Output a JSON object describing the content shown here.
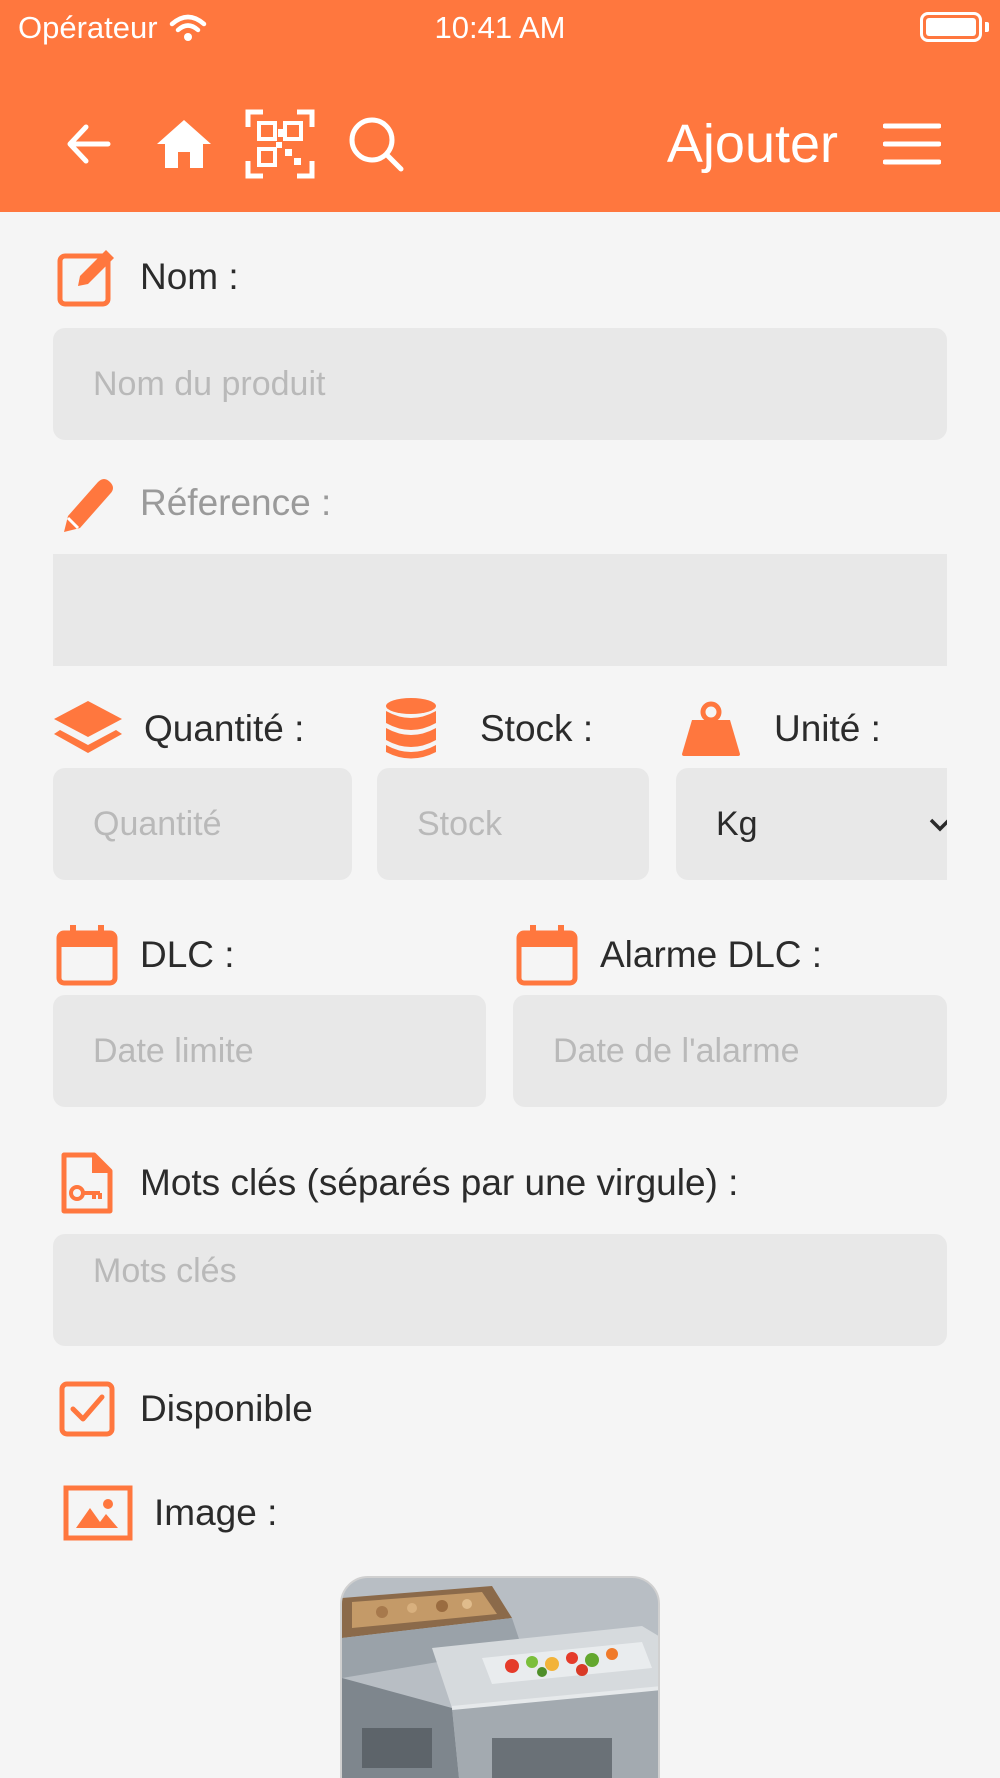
{
  "status_bar": {
    "carrier": "Opérateur",
    "time": "10:41 AM"
  },
  "header": {
    "title": "Ajouter"
  },
  "icons": {
    "back": "arrow-left-icon",
    "home": "home-icon",
    "scan": "qr-code-icon",
    "search": "search-icon",
    "menu": "hamburger-menu-icon"
  },
  "colors": {
    "accent": "#ff773e",
    "field_bg": "#e8e8e8",
    "background": "#f5f5f5",
    "placeholder": "#b9b9b9",
    "text": "#2b2b2b"
  },
  "form": {
    "nom": {
      "label": "Nom :",
      "placeholder": "Nom du produit",
      "value": ""
    },
    "reference": {
      "label": "Réference :",
      "value": ""
    },
    "quantite": {
      "label": "Quantité :",
      "placeholder": "Quantité",
      "value": ""
    },
    "stock": {
      "label": "Stock :",
      "placeholder": "Stock",
      "value": ""
    },
    "unite": {
      "label": "Unité :",
      "selected": "Kg"
    },
    "dlc": {
      "label": "DLC :",
      "placeholder": "Date limite",
      "value": ""
    },
    "alarme_dlc": {
      "label": "Alarme DLC :",
      "placeholder": "Date de l'alarme",
      "value": ""
    },
    "mots_cles": {
      "label": "Mots clés (séparés par une virgule) :",
      "placeholder": "Mots clés",
      "value": ""
    },
    "disponible": {
      "label": "Disponible",
      "checked": true
    },
    "image": {
      "label": "Image :"
    }
  }
}
